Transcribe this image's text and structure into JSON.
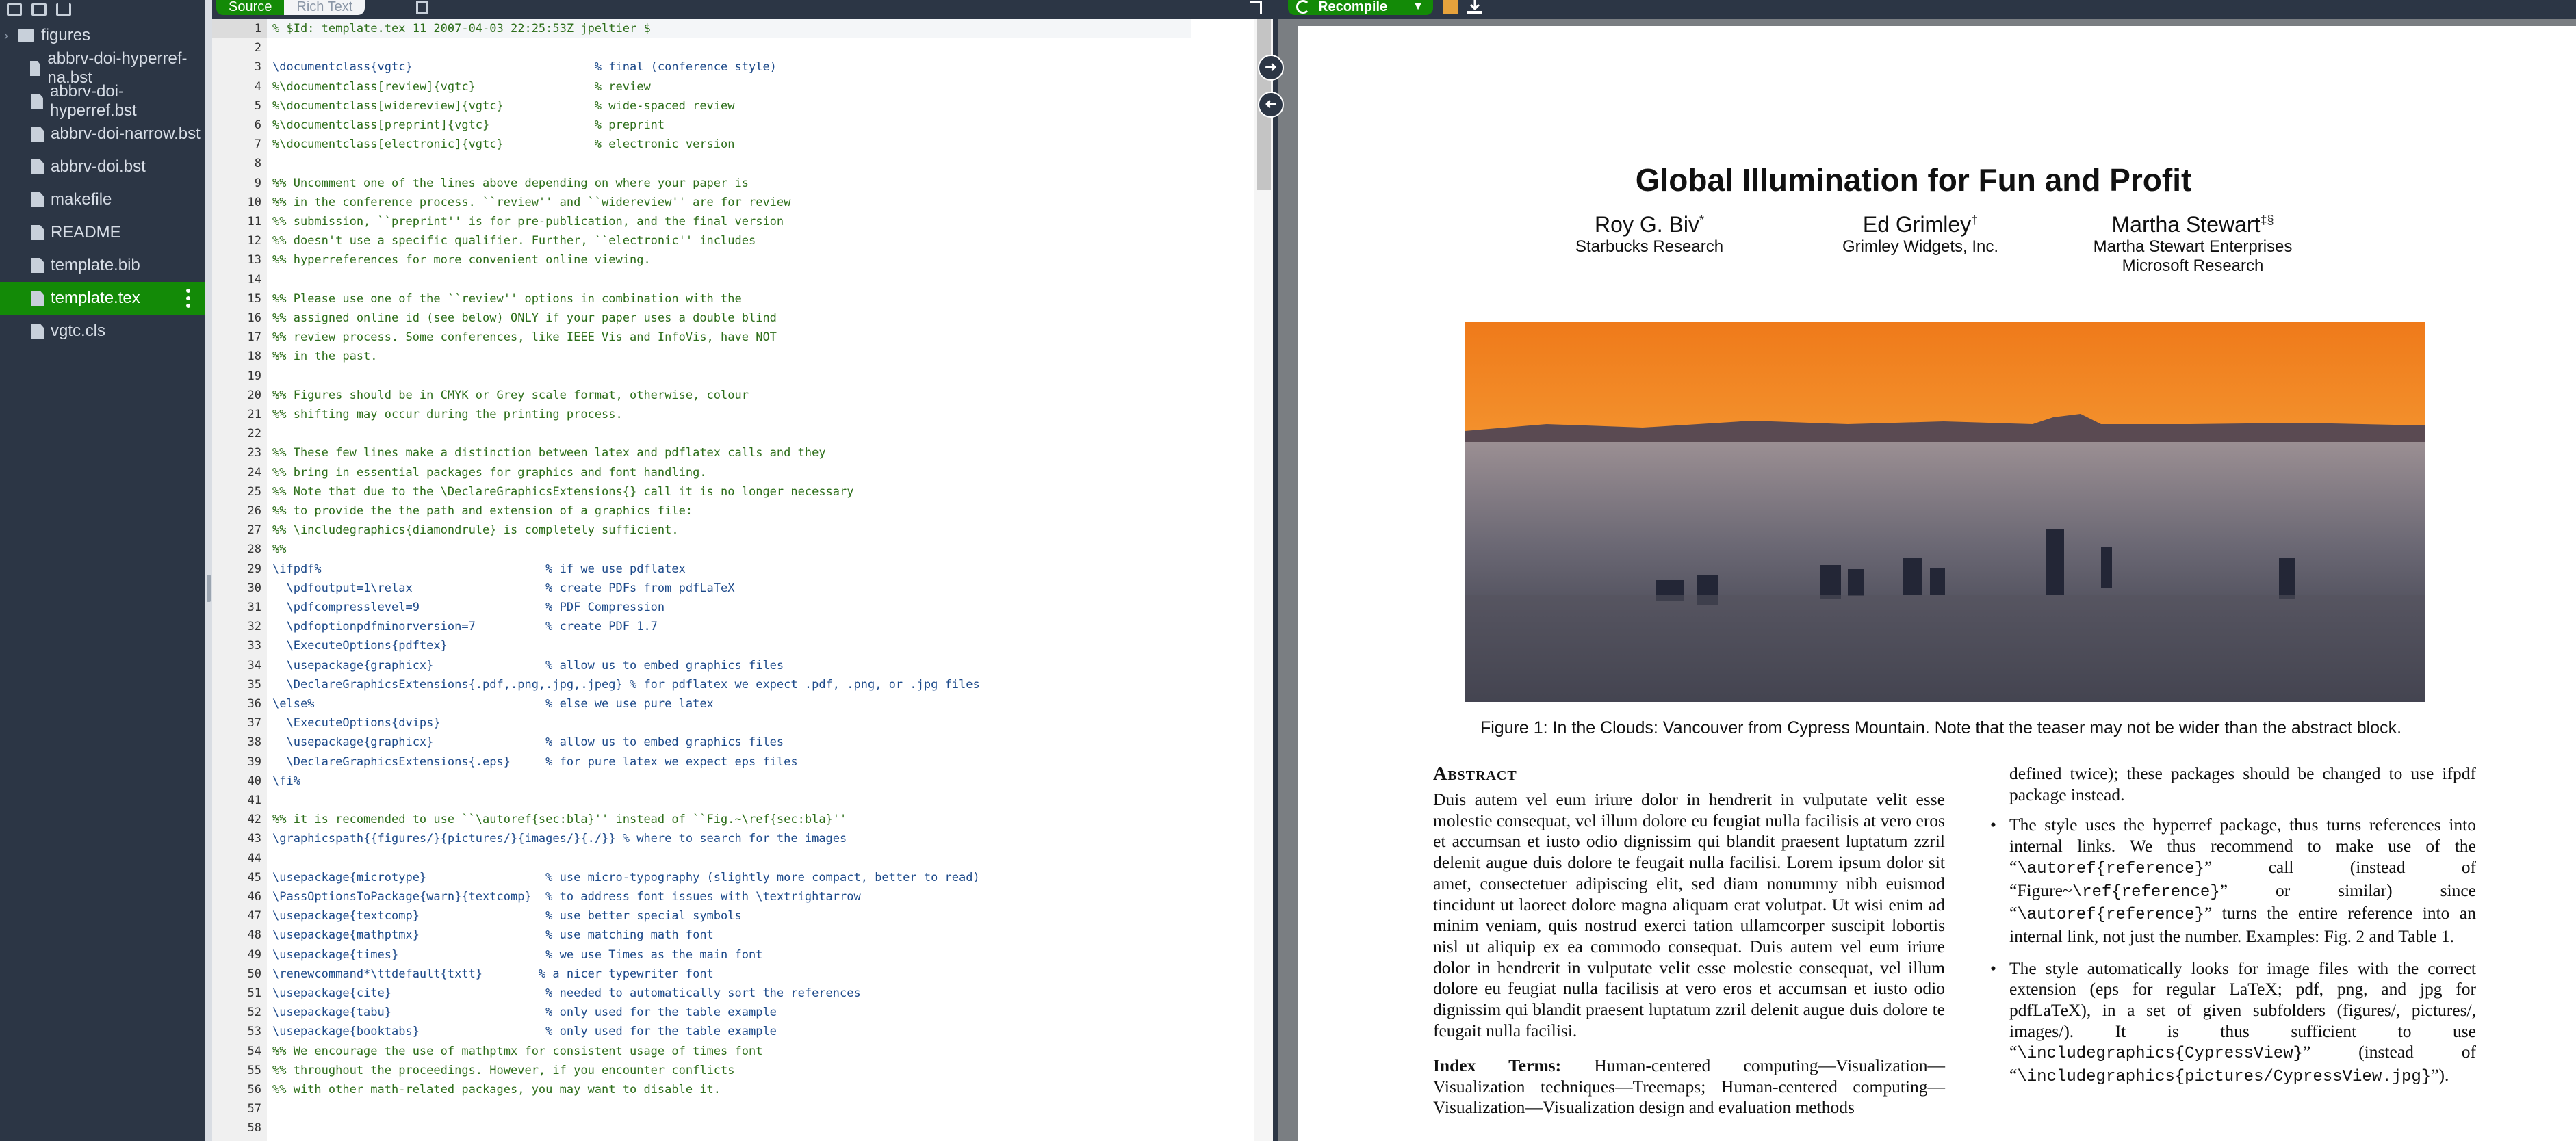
{
  "sidebar": {
    "items": [
      {
        "label": "figures",
        "kind": "folder"
      },
      {
        "label": "abbrv-doi-hyperref-na.bst",
        "kind": "file"
      },
      {
        "label": "abbrv-doi-hyperref.bst",
        "kind": "file"
      },
      {
        "label": "abbrv-doi-narrow.bst",
        "kind": "file"
      },
      {
        "label": "abbrv-doi.bst",
        "kind": "file"
      },
      {
        "label": "makefile",
        "kind": "file"
      },
      {
        "label": "README",
        "kind": "file"
      },
      {
        "label": "template.bib",
        "kind": "file"
      },
      {
        "label": "template.tex",
        "kind": "file",
        "selected": true
      },
      {
        "label": "vgtc.cls",
        "kind": "file"
      }
    ]
  },
  "editor_toolbar": {
    "source_label": "Source",
    "rich_label": "Rich Text"
  },
  "pdf_toolbar": {
    "recompile_label": "Recompile"
  },
  "editor": {
    "active_line": 1,
    "lines": [
      "% $Id: template.tex 11 2007-04-03 22:25:53Z jpeltier $",
      "",
      "\\documentclass{vgtc}                          % final (conference style)",
      "%\\documentclass[review]{vgtc}                 % review",
      "%\\documentclass[widereview]{vgtc}             % wide-spaced review",
      "%\\documentclass[preprint]{vgtc}               % preprint",
      "%\\documentclass[electronic]{vgtc}             % electronic version",
      "",
      "%% Uncomment one of the lines above depending on where your paper is",
      "%% in the conference process. ``review'' and ``widereview'' are for review",
      "%% submission, ``preprint'' is for pre-publication, and the final version",
      "%% doesn't use a specific qualifier. Further, ``electronic'' includes",
      "%% hyperreferences for more convenient online viewing.",
      "",
      "%% Please use one of the ``review'' options in combination with the",
      "%% assigned online id (see below) ONLY if your paper uses a double blind",
      "%% review process. Some conferences, like IEEE Vis and InfoVis, have NOT",
      "%% in the past.",
      "",
      "%% Figures should be in CMYK or Grey scale format, otherwise, colour",
      "%% shifting may occur during the printing process.",
      "",
      "%% These few lines make a distinction between latex and pdflatex calls and they",
      "%% bring in essential packages for graphics and font handling.",
      "%% Note that due to the \\DeclareGraphicsExtensions{} call it is no longer necessary",
      "%% to provide the the path and extension of a graphics file:",
      "%% \\includegraphics{diamondrule} is completely sufficient.",
      "%%",
      "\\ifpdf%                                % if we use pdflatex",
      "  \\pdfoutput=1\\relax                   % create PDFs from pdfLaTeX",
      "  \\pdfcompresslevel=9                  % PDF Compression",
      "  \\pdfoptionpdfminorversion=7          % create PDF 1.7",
      "  \\ExecuteOptions{pdftex}",
      "  \\usepackage{graphicx}                % allow us to embed graphics files",
      "  \\DeclareGraphicsExtensions{.pdf,.png,.jpg,.jpeg} % for pdflatex we expect .pdf, .png, or .jpg files",
      "\\else%                                 % else we use pure latex",
      "  \\ExecuteOptions{dvips}",
      "  \\usepackage{graphicx}                % allow us to embed graphics files",
      "  \\DeclareGraphicsExtensions{.eps}     % for pure latex we expect eps files",
      "\\fi%",
      "",
      "%% it is recomended to use ``\\autoref{sec:bla}'' instead of ``Fig.~\\ref{sec:bla}''",
      "\\graphicspath{{figures/}{pictures/}{images/}{./}} % where to search for the images",
      "",
      "\\usepackage{microtype}                 % use micro-typography (slightly more compact, better to read)",
      "\\PassOptionsToPackage{warn}{textcomp}  % to address font issues with \\textrightarrow",
      "\\usepackage{textcomp}                  % use better special symbols",
      "\\usepackage{mathptmx}                  % use matching math font",
      "\\usepackage{times}                     % we use Times as the main font",
      "\\renewcommand*\\ttdefault{txtt}        % a nicer typewriter font",
      "\\usepackage{cite}                      % needed to automatically sort the references",
      "\\usepackage{tabu}                      % only used for the table example",
      "\\usepackage{booktabs}                  % only used for the table example",
      "%% We encourage the use of mathptmx for consistent usage of times font",
      "%% throughout the proceedings. However, if you encounter conflicts",
      "%% with other math-related packages, you may want to disable it.",
      "",
      ""
    ]
  },
  "paper": {
    "title": "Global Illumination for Fun and Profit",
    "authors": [
      {
        "name": "Roy G. Biv",
        "mark": "*",
        "affiliation": "Starbucks Research",
        "affiliation2": ""
      },
      {
        "name": "Ed Grimley",
        "mark": "†",
        "affiliation": "Grimley Widgets, Inc.",
        "affiliation2": ""
      },
      {
        "name": "Martha Stewart",
        "mark": "‡§",
        "affiliation": "Martha Stewart Enterprises",
        "affiliation2": "Microsoft Research"
      }
    ],
    "caption": "Figure 1: In the Clouds: Vancouver from Cypress Mountain. Note that the teaser may not be wider than the abstract block.",
    "abstract_heading": "Abstract",
    "abstract_text": "Duis autem vel eum iriure dolor in hendrerit in vulputate velit esse molestie consequat, vel illum dolore eu feugiat nulla facilisis at vero eros et accumsan et iusto odio dignissim qui blandit praesent luptatum zzril delenit augue duis dolore te feugait nulla facilisi. Lorem ipsum dolor sit amet, consectetuer adipiscing elit, sed diam nonummy nibh euismod tincidunt ut laoreet dolore magna aliquam erat volutpat. Ut wisi enim ad minim veniam, quis nostrud exerci tation ullamcorper suscipit lobortis nisl ut aliquip ex ea commodo consequat. Duis autem vel eum iriure dolor in hendrerit in vulputate velit esse molestie consequat, vel illum dolore eu feugiat nulla facilisis at vero eros et accumsan et iusto odio dignissim qui blandit praesent luptatum zzril delenit augue duis dolore te feugait nulla facilisi.",
    "index_terms_label": "Index Terms:",
    "index_terms_text": "Human-centered computing—Visualization—Visualization techniques—Treemaps; Human-centered computing—Visualization—Visualization design and evaluation methods",
    "right_col_intro": "defined twice); these packages should be changed to use ifpdf package instead.",
    "bullet1_a": "The style uses the hyperref package, thus turns references into internal links. We thus recommend to make use of the “",
    "bullet1_code1": "\\autoref{reference}",
    "bullet1_b": "” call (instead of “Figure~",
    "bullet1_code2": "\\ref{reference}",
    "bullet1_c": "” or similar) since “",
    "bullet1_code3": "\\autoref{reference}",
    "bullet1_d": "” turns the entire reference into an internal link, not just the number. Examples: Fig. 2 and Table 1.",
    "bullet2_a": "The style automatically looks for image files with the correct extension (eps for regular LaTeX; pdf, png, and jpg for pdfLaTeX), in a set of given subfolders (figures/, pictures/, images/). It is thus sufficient to use “",
    "bullet2_code1": "\\includegraphics{CypressView}",
    "bullet2_b": "” (instead of “",
    "bullet2_code2": "\\includegraphics{pictures/CypressView.jpg}",
    "bullet2_c": "”)."
  }
}
